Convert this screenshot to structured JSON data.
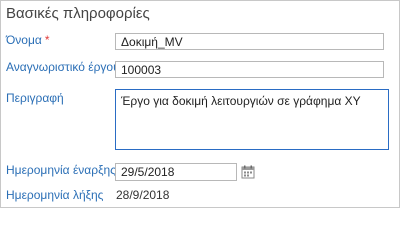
{
  "section": {
    "title": "Βασικές πληροφορίες"
  },
  "fields": {
    "name": {
      "label": "Όνομα",
      "required_mark": "*",
      "value": "Δοκιμή_MV"
    },
    "project_id": {
      "label": "Αναγνωριστικό έργου",
      "value": "100003"
    },
    "description": {
      "label": "Περιγραφή",
      "value": "Έργο για δοκιμή λειτουργιών σε γράφημα ΧΥ"
    },
    "start_date": {
      "label": "Ημερομηνία έναρξης",
      "required_mark": "*",
      "value": "29/5/2018"
    },
    "end_date": {
      "label": "Ημερομηνία λήξης",
      "value": "28/9/2018"
    }
  },
  "icons": {
    "date_picker": "calendar-icon"
  },
  "colors": {
    "label": "#2b6fb6",
    "required": "#e03a3a",
    "focus_border": "#2a6cc4",
    "border": "#b8b8b8"
  }
}
